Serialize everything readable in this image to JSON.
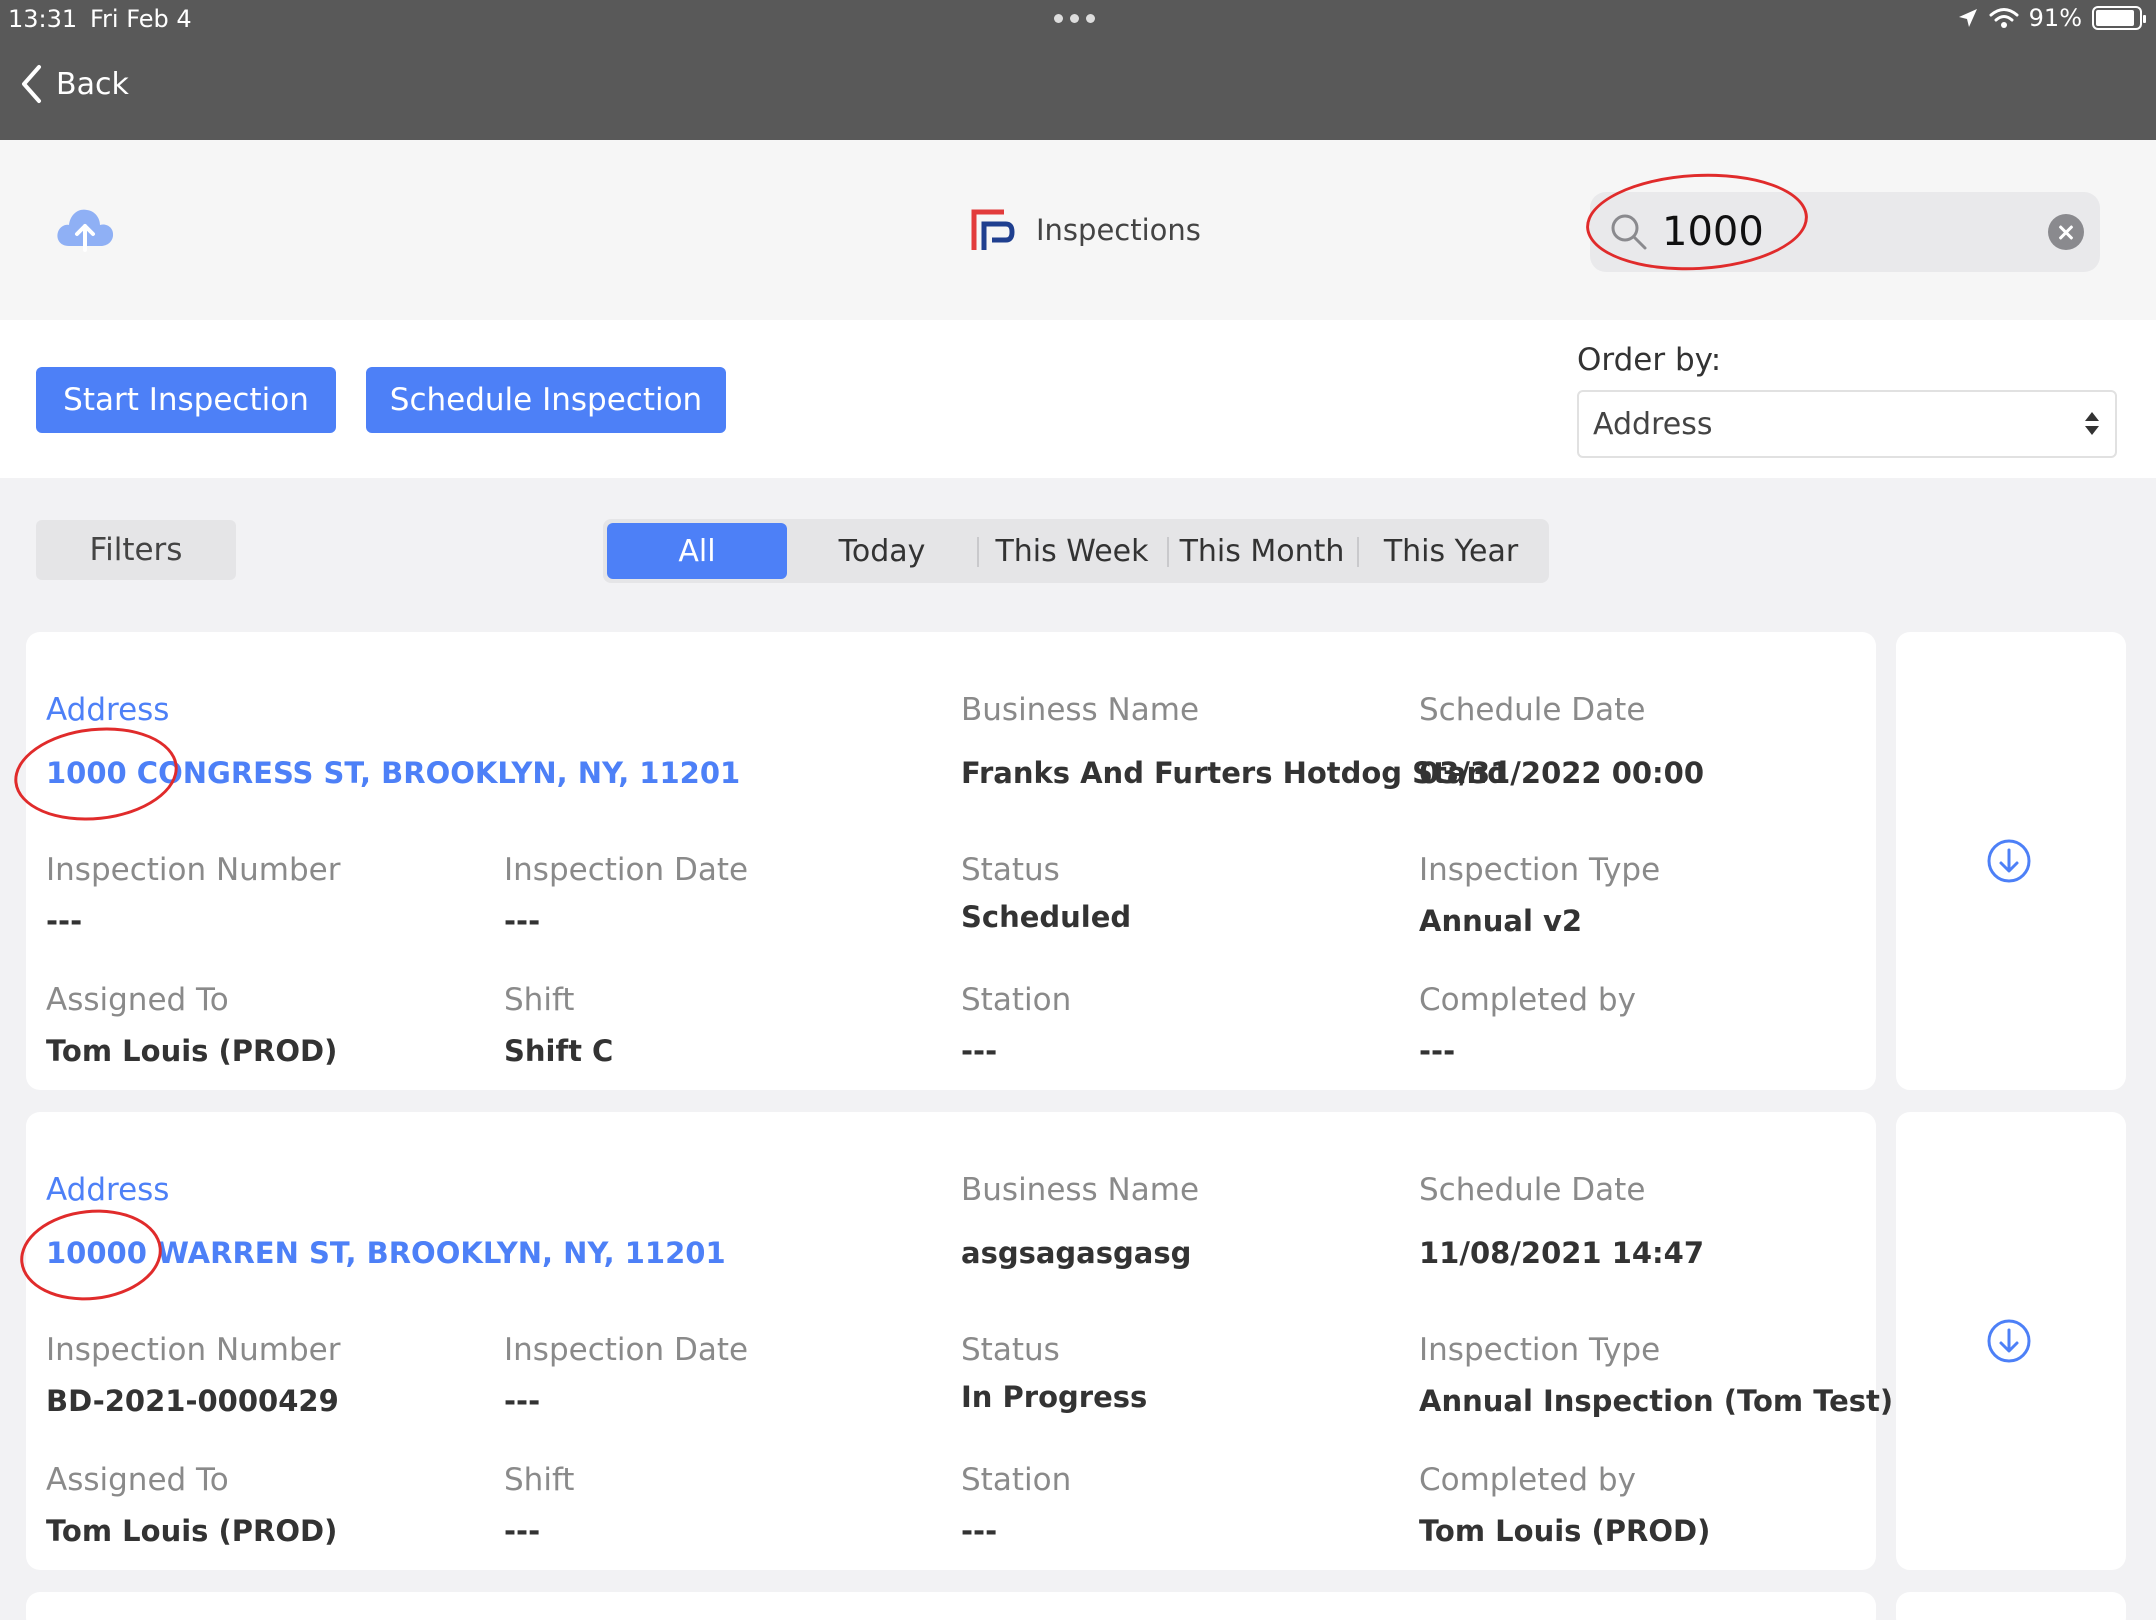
{
  "status_bar": {
    "time": "13:31",
    "date": "Fri Feb 4",
    "battery": "91%",
    "battery_level": 0.91
  },
  "nav": {
    "back_label": "Back"
  },
  "header": {
    "title": "Inspections",
    "search_value": "1000"
  },
  "actions": {
    "start_label": "Start Inspection",
    "schedule_label": "Schedule Inspection"
  },
  "order": {
    "label": "Order by:",
    "selected": "Address"
  },
  "filters_label": "Filters",
  "periods": [
    "All",
    "Today",
    "This Week",
    "This Month",
    "This Year"
  ],
  "active_period": "All",
  "labels": {
    "address": "Address",
    "business": "Business Name",
    "schedule": "Schedule Date",
    "number": "Inspection Number",
    "date": "Inspection Date",
    "status": "Status",
    "type": "Inspection Type",
    "assigned": "Assigned To",
    "shift": "Shift",
    "station": "Station",
    "completed": "Completed by"
  },
  "inspections": [
    {
      "address": "1000 CONGRESS ST, BROOKLYN, NY, 11201",
      "business": "Franks And Furters Hotdog Stand",
      "schedule": "03/31/2022 00:00",
      "number": "---",
      "date": "---",
      "status": "Scheduled",
      "type": "Annual v2",
      "assigned": "Tom Louis (PROD)",
      "shift": "Shift C",
      "station": "---",
      "completed": "---"
    },
    {
      "address": "10000 WARREN ST, BROOKLYN, NY, 11201",
      "business": "asgsagasgasg",
      "schedule": "11/08/2021 14:47",
      "number": "BD-2021-0000429",
      "date": "---",
      "status": "In Progress",
      "type": "Annual Inspection (Tom Test)",
      "assigned": "Tom Louis (PROD)",
      "shift": "---",
      "station": "---",
      "completed": "Tom Louis (PROD)"
    }
  ],
  "colors": {
    "accent": "#4d80f7",
    "annotation": "#e02b2b",
    "nav_bar": "#595959"
  }
}
